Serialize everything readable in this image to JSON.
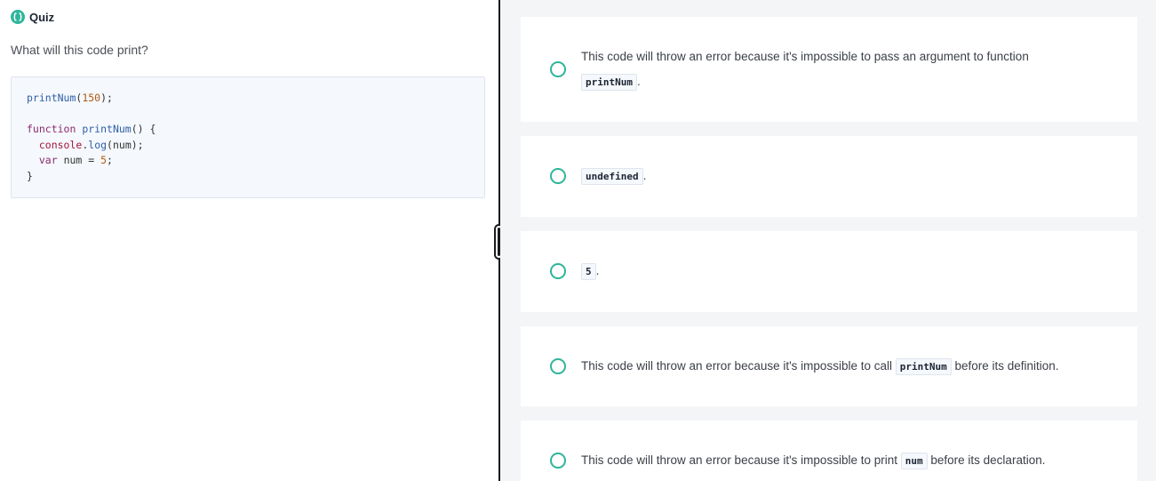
{
  "quiz": {
    "title": "Quiz",
    "question": "What will this code print?"
  },
  "code": {
    "l1_fn": "printNum",
    "l1_open": "(",
    "l1_num": "150",
    "l1_close": ");",
    "l3_kw": "function",
    "l3_fn": "printNum",
    "l3_rest": "() {",
    "l4_obj": "console",
    "l4_dot": ".",
    "l4_fn": "log",
    "l4_rest": "(num);",
    "l5_kw": "var",
    "l5_mid": " num = ",
    "l5_num": "5",
    "l5_end": ";",
    "l6": "}"
  },
  "options": [
    {
      "text": "This code will throw an error because it's impossible to pass an argument to function",
      "code": "printNum",
      "suffix": "."
    },
    {
      "code": "undefined",
      "suffix": "."
    },
    {
      "code": "5",
      "suffix": "."
    },
    {
      "before": "This code will throw an error because it's impossible to call",
      "code": "printNum",
      "after": "before its definition."
    },
    {
      "before": "This code will throw an error because it's impossible to print",
      "code": "num",
      "after": "before its declaration."
    }
  ],
  "colors": {
    "accent": "#2fb59a",
    "panel_bg": "#f4f5f7"
  }
}
